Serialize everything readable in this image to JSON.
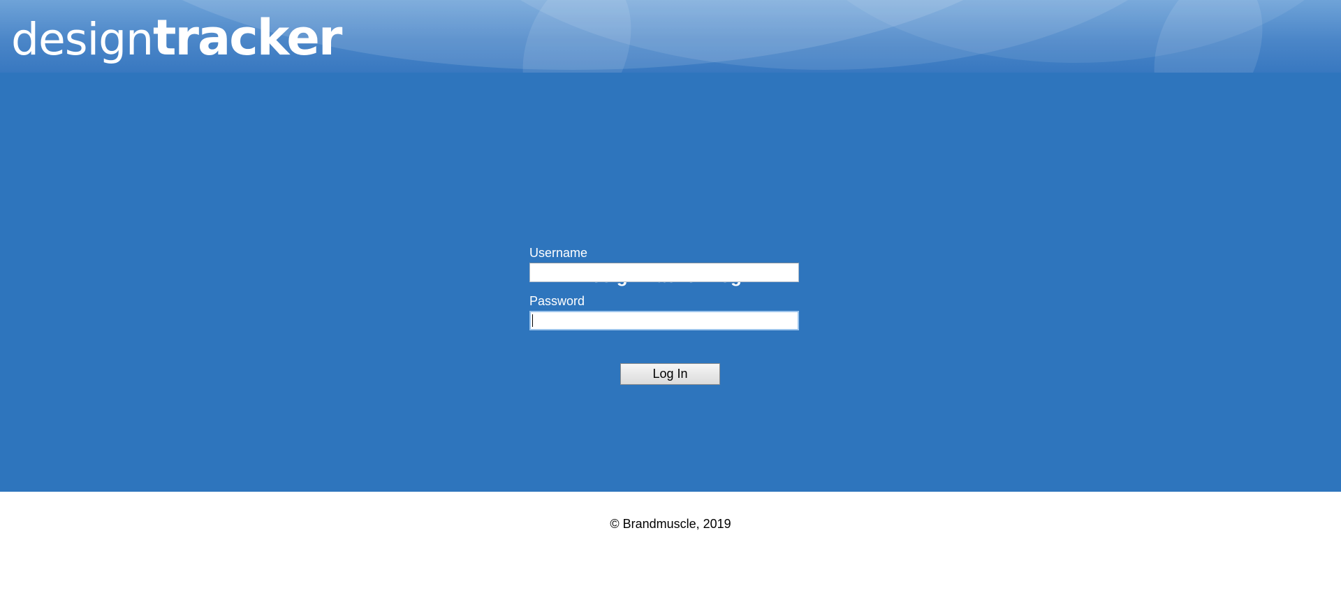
{
  "header": {
    "logo_light": "design",
    "logo_bold": "tracker"
  },
  "login": {
    "title": "DesignTracker Log In",
    "username_label": "Username",
    "username_value": "",
    "password_label": "Password",
    "password_value": "",
    "submit_label": "Log In"
  },
  "footer": {
    "copyright": "© Brandmuscle, 2019"
  },
  "colors": {
    "main_background": "#2e75bd",
    "header_background": "#4b86c8",
    "text_on_blue": "#ffffff",
    "footer_background": "#ffffff"
  }
}
